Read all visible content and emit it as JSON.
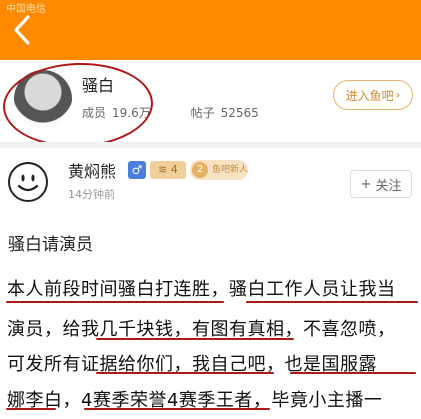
{
  "status_bar": {
    "text": "中国电信"
  },
  "forum": {
    "name": "骚白",
    "members_label": "成员",
    "members_value": "19.6万",
    "posts_label": "帖子",
    "posts_value": "52565",
    "enter_label": "进入鱼吧",
    "enter_arrow": "›"
  },
  "post": {
    "author": "黄焖熊",
    "gender_symbol": "♂",
    "level_badge": "≋ 4",
    "fish_badge_num": "2",
    "fish_badge_text": "鱼吧新人",
    "time": "14分钟前",
    "follow_plus": "+",
    "follow_label": "关注",
    "title": "骚白请演员",
    "lines": [
      "本人前段时间骚白打连胜，骚白工作人员让我当",
      "演员，给我几千块钱，有图有真相，不喜忽喷，",
      "可发所有证据给你们，我自己吧，也是国服露",
      "娜李白，4赛季荣誉4赛季王者，毕竟小主播一"
    ]
  }
}
